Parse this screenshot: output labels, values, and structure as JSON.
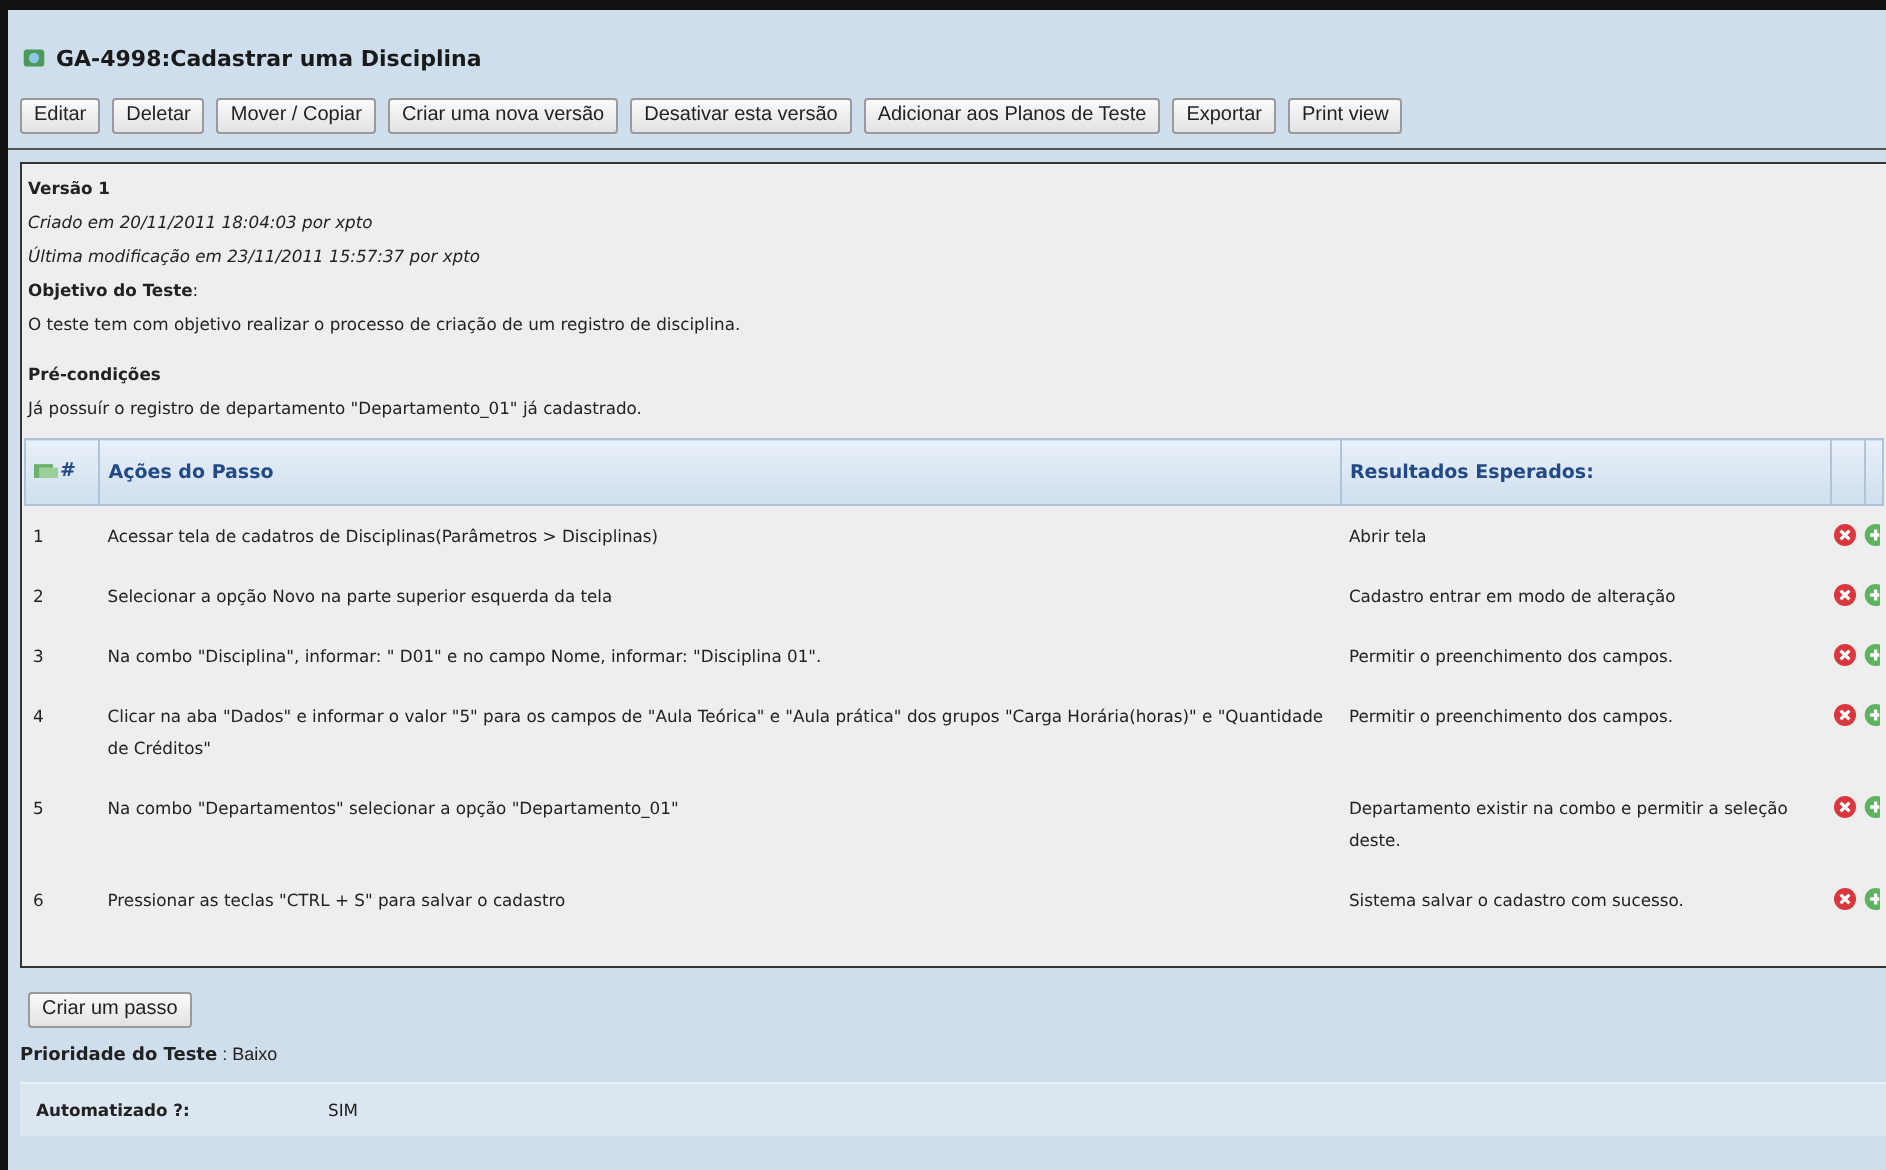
{
  "title": "GA-4998:Cadastrar uma Disciplina",
  "toolbar": [
    "Editar",
    "Deletar",
    "Mover / Copiar",
    "Criar uma nova versão",
    "Desativar esta versão",
    "Adicionar aos Planos de Teste",
    "Exportar",
    "Print view"
  ],
  "version": "Versão 1",
  "created": "Criado em  20/11/2011 18:04:03  por xpto",
  "modified": "Última modificação em  23/11/2011 15:57:37  por xpto",
  "objective": {
    "label": "Objetivo do Teste",
    "separator": ":",
    "text": "O teste tem com objetivo realizar o processo de criação de um registro de disciplina."
  },
  "preconditions": {
    "label": "Pré-condições",
    "text": "Já possuír o registro de departamento \"Departamento_01\" já cadastrado."
  },
  "table": {
    "columns": [
      "#",
      "Ações do Passo",
      "Resultados Esperados:"
    ],
    "rows": [
      {
        "number": "1",
        "action": "Acessar tela de cadatros de Disciplinas(Parâmetros > Disciplinas)",
        "result": "Abrir tela"
      },
      {
        "number": "2",
        "action": "Selecionar a opção Novo na parte superior esquerda da tela",
        "result": "Cadastro entrar em modo de alteração"
      },
      {
        "number": "3",
        "action": "Na combo \"Disciplina\", informar: \" D01\" e no campo Nome, informar: \"Disciplina 01\".",
        "result": "Permitir o preenchimento dos campos."
      },
      {
        "number": "4",
        "action": "Clicar na aba \"Dados\" e informar o valor \"5\" para os campos de \"Aula Teórica\" e \"Aula prática\" dos grupos \"Carga Horária(horas)\" e \"Quantidade de Créditos\"",
        "result": "Permitir o preenchimento dos campos."
      },
      {
        "number": "5",
        "action": "Na combo \"Departamentos\" selecionar a opção \"Departamento_01\"",
        "result": "Departamento existir na combo e permitir a seleção deste."
      },
      {
        "number": "6",
        "action": "Pressionar as teclas \"CTRL + S\" para salvar o cadastro",
        "result": "Sistema salvar o cadastro com sucesso."
      }
    ]
  },
  "create_step": "Criar um passo",
  "priority": {
    "label": "Prioridade do Teste",
    "separator": " : ",
    "value": "Baixo"
  },
  "automated": {
    "label": "Automatizado ?:",
    "value": "SIM"
  }
}
